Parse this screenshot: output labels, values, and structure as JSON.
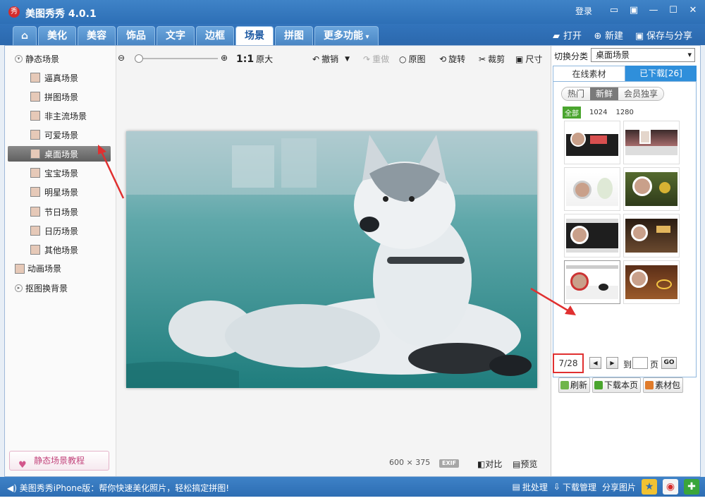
{
  "window": {
    "title": "美图秀秀 4.0.1",
    "app_icon": "秀",
    "login": "登录"
  },
  "tabs": [
    {
      "label": "美化"
    },
    {
      "label": "美容"
    },
    {
      "label": "饰品"
    },
    {
      "label": "文字"
    },
    {
      "label": "边框"
    },
    {
      "label": "场景",
      "active": true
    },
    {
      "label": "拼图"
    },
    {
      "label": "更多功能"
    }
  ],
  "top_actions": {
    "open": "打开",
    "new": "新建",
    "save_share": "保存与分享"
  },
  "left_panel": {
    "static_root": "静态场景",
    "items": [
      {
        "label": "逼真场景"
      },
      {
        "label": "拼图场景"
      },
      {
        "label": "非主流场景"
      },
      {
        "label": "可爱场景"
      },
      {
        "label": "桌面场景",
        "selected": true
      },
      {
        "label": "宝宝场景"
      },
      {
        "label": "明星场景"
      },
      {
        "label": "节日场景"
      },
      {
        "label": "日历场景"
      },
      {
        "label": "其他场景"
      }
    ],
    "animated_root": "动画场景",
    "cutout_root": "抠图换背景",
    "tutorial": "静态场景教程"
  },
  "toolbar": {
    "ratio": "1:1",
    "original_size": "原大",
    "undo": "撤销",
    "redo": "重做",
    "original": "原图",
    "rotate": "旋转",
    "crop": "裁剪",
    "size": "尺寸"
  },
  "canvas": {
    "width": "600",
    "times": "×",
    "height": "375",
    "exif": "EXIF",
    "compare": "对比",
    "preview": "预览"
  },
  "right_panel": {
    "category_label": "切换分类",
    "category_value": "桌面场景",
    "tab_online": "在线素材",
    "tab_downloaded": "已下载[26]",
    "subtabs": [
      "热门",
      "新鲜",
      "会员独享"
    ],
    "sizes": [
      "全部",
      "1024",
      "1280"
    ],
    "page_current": "7/28",
    "goto": "到",
    "page_unit": "页",
    "go": "GO",
    "refresh": "刷新",
    "download_page": "下载本页",
    "package": "素材包"
  },
  "status": {
    "message": "美图秀秀iPhone版：帮你快速美化照片，轻松搞定拼图!",
    "batch": "批处理",
    "download_manage": "下载管理",
    "share_image": "分享图片"
  },
  "colors": {
    "chrome_blue": "#2d6fb6",
    "accent_red": "#e03030",
    "accent_green": "#4aa52e"
  }
}
